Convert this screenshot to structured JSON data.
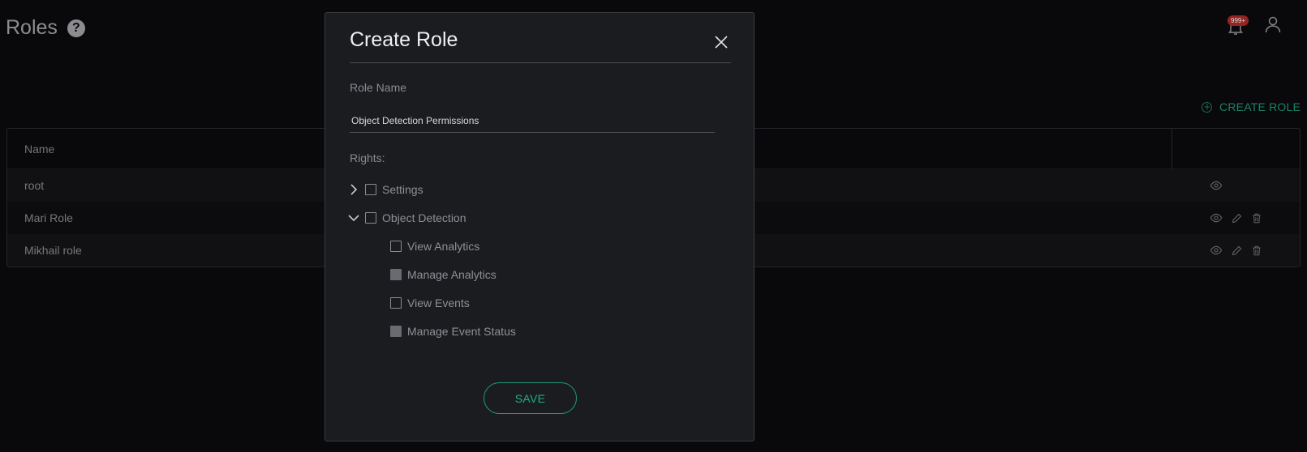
{
  "header": {
    "title": "Roles",
    "help_icon": "question-circle-icon"
  },
  "notifications": {
    "badge": "999+",
    "icon": "bell-icon"
  },
  "user": {
    "icon": "user-icon"
  },
  "toolbar": {
    "create_role_label": "CREATE ROLE",
    "accent": "#1f9a78"
  },
  "table": {
    "columns": [
      "Name"
    ],
    "rows": [
      {
        "name": "root",
        "actions": [
          "view"
        ]
      },
      {
        "name": "Mari Role",
        "actions": [
          "view",
          "edit",
          "delete"
        ]
      },
      {
        "name": "Mikhail role",
        "actions": [
          "view",
          "edit",
          "delete"
        ]
      }
    ]
  },
  "modal": {
    "title": "Create Role",
    "role_name_label": "Role Name",
    "role_name_value": "Object Detection Permissions",
    "rights_label": "Rights:",
    "rights": [
      {
        "label": "Settings",
        "expanded": false,
        "checked": false,
        "children": []
      },
      {
        "label": "Object Detection",
        "expanded": true,
        "checked": false,
        "children": [
          {
            "label": "View Analytics",
            "checked": false
          },
          {
            "label": "Manage Analytics",
            "checked": true
          },
          {
            "label": "View Events",
            "checked": false
          },
          {
            "label": "Manage Event Status",
            "checked": true
          }
        ]
      }
    ],
    "save_label": "SAVE"
  }
}
